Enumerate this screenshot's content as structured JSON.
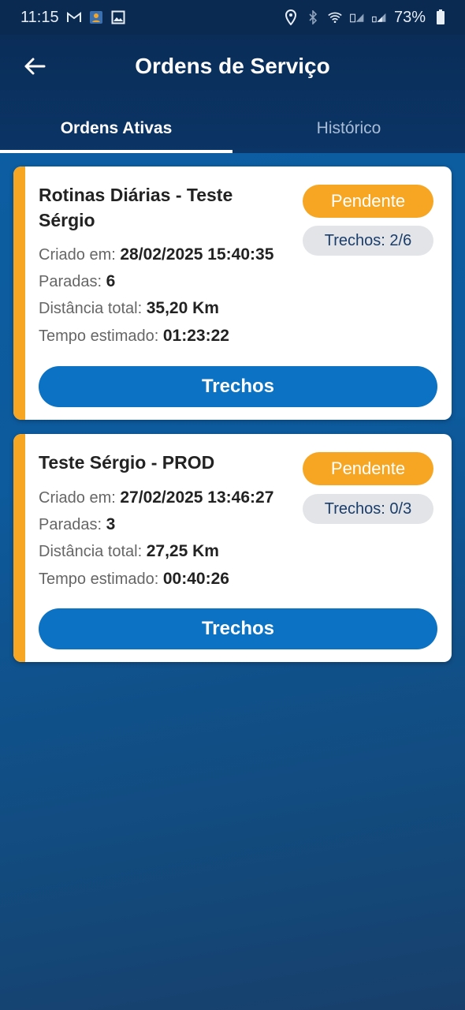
{
  "status_bar": {
    "time": "11:15",
    "battery": "73%",
    "left_icons": [
      "gmail-icon",
      "app-notification-icon",
      "gallery-icon"
    ],
    "right_icons": [
      "location-icon",
      "bluetooth-icon",
      "wifi-icon",
      "signal-icon",
      "signal-icon-2",
      "battery-icon"
    ]
  },
  "header": {
    "title": "Ordens de Serviço",
    "back_icon": "arrow-left-icon"
  },
  "tabs": [
    {
      "label": "Ordens Ativas",
      "active": true
    },
    {
      "label": "Histórico",
      "active": false
    }
  ],
  "labels": {
    "created": "Criado em: ",
    "stops": "Paradas: ",
    "distance": "Distância total: ",
    "time": "Tempo estimado: "
  },
  "orders": [
    {
      "title": "Rotinas Diárias - Teste Sérgio",
      "status": "Pendente",
      "trechos_badge": "Trechos: 2/6",
      "created": "28/02/2025 15:40:35",
      "stops": "6",
      "distance": "35,20 Km",
      "time": "01:23:22",
      "button": "Trechos"
    },
    {
      "title": "Teste Sérgio - PROD",
      "status": "Pendente",
      "trechos_badge": "Trechos: 0/3",
      "created": "27/02/2025 13:46:27",
      "stops": "3",
      "distance": "27,25 Km",
      "time": "00:40:26",
      "button": "Trechos"
    }
  ],
  "colors": {
    "accent": "#f6a623",
    "button": "#0b72c4",
    "header": "#0a2d58"
  }
}
